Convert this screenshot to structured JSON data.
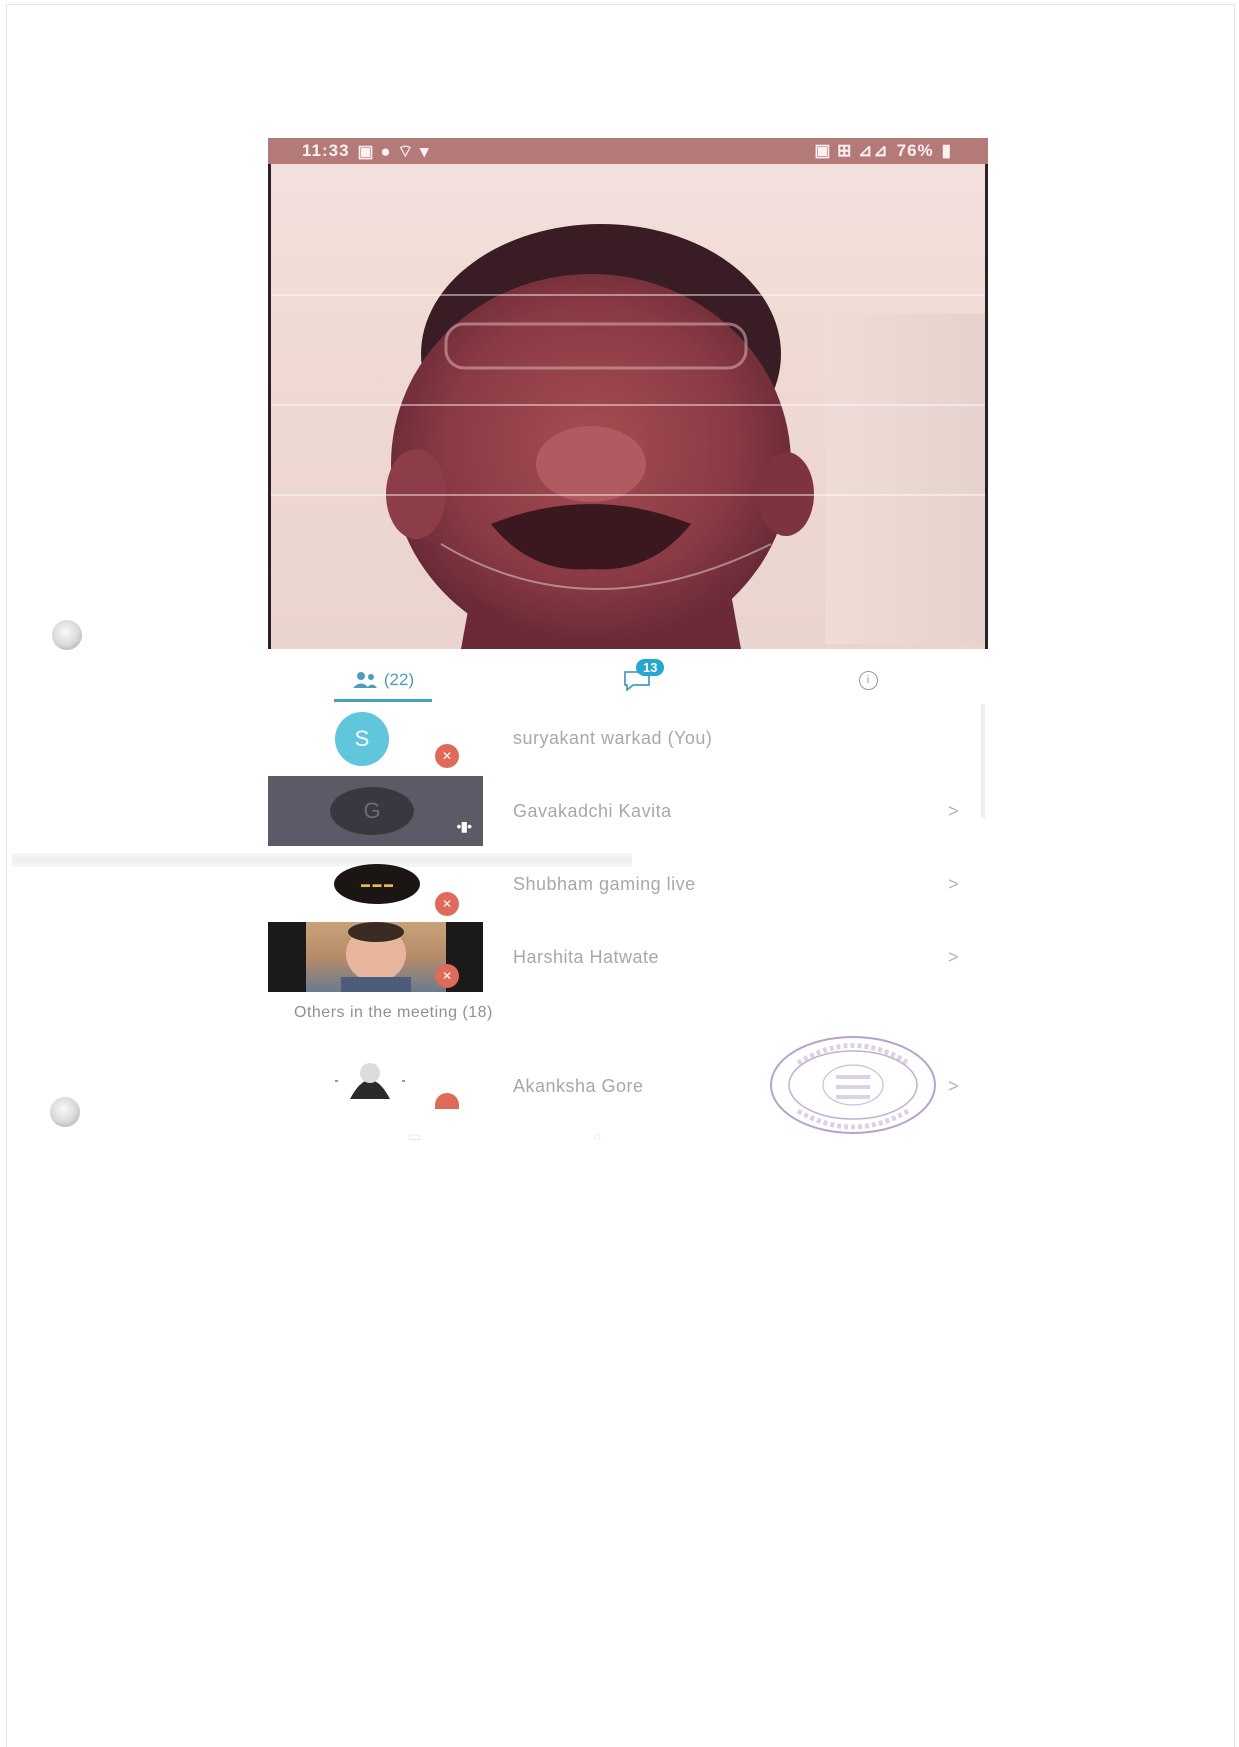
{
  "status_bar": {
    "time": "11:33",
    "battery": "76%"
  },
  "tabs": {
    "participants_count": "(22)",
    "chat_badge": "13"
  },
  "participants": [
    {
      "name": "suryakant warkad (You)",
      "avatar_letter": "S",
      "has_chevron": false,
      "mic": "muted"
    },
    {
      "name": "Gavakadchi Kavita",
      "avatar_letter": "G",
      "has_chevron": true,
      "mic": "speaking"
    },
    {
      "name": "Shubham gaming live",
      "has_chevron": true,
      "mic": "muted"
    },
    {
      "name": "Harshita Hatwate",
      "has_chevron": true,
      "mic": "muted"
    }
  ],
  "others_section": {
    "label": "Others in the meeting (18)",
    "participants": [
      {
        "name": "Akanksha Gore",
        "has_chevron": true,
        "mic": "muted"
      }
    ]
  },
  "colors": {
    "accent": "#4a9fc0",
    "chat_badge": "#27a6d0",
    "avatar_s": "#5fc6dc",
    "mic_off": "#e06a5a",
    "status_bar": "#b47a7a",
    "stamp": "#9a7ab8"
  },
  "icons": [
    "people-icon",
    "chat-icon",
    "info-icon",
    "chevron-right-icon",
    "mic-off-icon",
    "speaking-indicator-icon",
    "battery-icon",
    "signal-icon"
  ]
}
